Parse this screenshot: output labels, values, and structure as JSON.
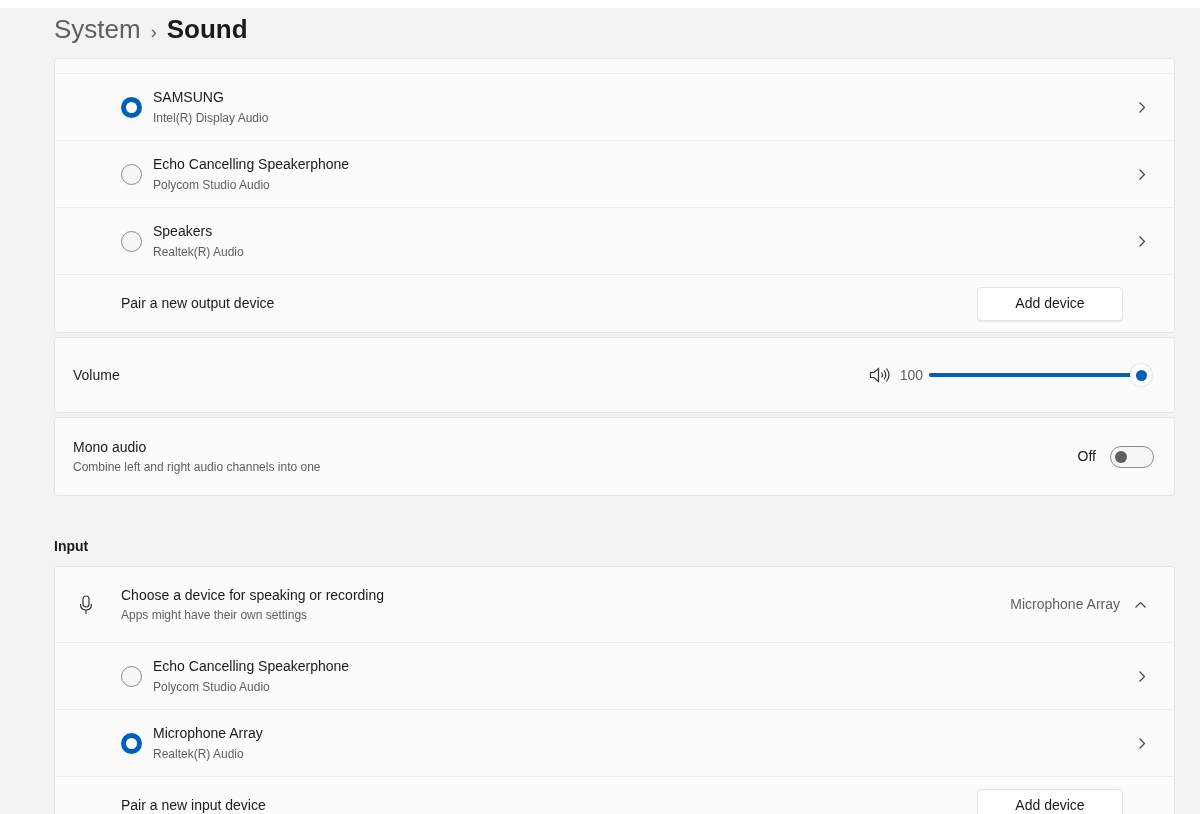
{
  "breadcrumb": {
    "parent": "System",
    "separator": "›",
    "current": "Sound"
  },
  "output": {
    "devices": [
      {
        "name": "SAMSUNG",
        "driver": "Intel(R) Display Audio",
        "selected": true
      },
      {
        "name": "Echo Cancelling Speakerphone",
        "driver": "Polycom Studio Audio",
        "selected": false
      },
      {
        "name": "Speakers",
        "driver": "Realtek(R) Audio",
        "selected": false
      }
    ],
    "pair_label": "Pair a new output device",
    "pair_button": "Add device"
  },
  "volume": {
    "label": "Volume",
    "reading": "100",
    "level": 1
  },
  "mono_audio": {
    "title": "Mono audio",
    "description": "Combine left and right audio channels into one",
    "state_label": "Off",
    "on": false
  },
  "input": {
    "heading": "Input",
    "title": "Choose a device for speaking or recording",
    "description": "Apps might have their own settings",
    "current": "Microphone Array",
    "expanded": true,
    "devices": [
      {
        "name": "Echo Cancelling Speakerphone",
        "driver": "Polycom Studio Audio",
        "selected": false
      },
      {
        "name": "Microphone Array",
        "driver": "Realtek(R) Audio",
        "selected": true
      }
    ],
    "pair_label": "Pair a new input device",
    "pair_button": "Add device"
  }
}
